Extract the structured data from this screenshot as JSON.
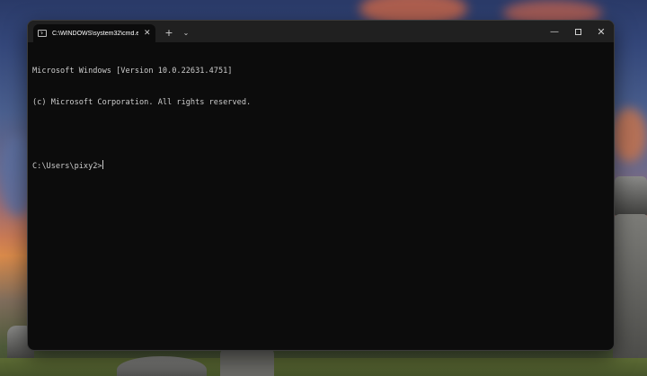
{
  "desktop": {
    "wallpaper": "stonehenge-sunset"
  },
  "terminal": {
    "tab": {
      "title": "C:\\WINDOWS\\system32\\cmd.exe",
      "icon": "console-icon",
      "close_glyph": "✕"
    },
    "new_tab_glyph": "+",
    "dropdown_glyph": "⌄",
    "window_controls": {
      "minimize_glyph": "—",
      "close_glyph": "✕"
    },
    "output_lines": [
      "Microsoft Windows [Version 10.0.22631.4751]",
      "(c) Microsoft Corporation. All rights reserved.",
      ""
    ],
    "prompt": "C:\\Users\\pixy2>",
    "colors": {
      "background": "#0c0c0c",
      "titlebar": "#202020",
      "text": "#cccccc"
    }
  }
}
